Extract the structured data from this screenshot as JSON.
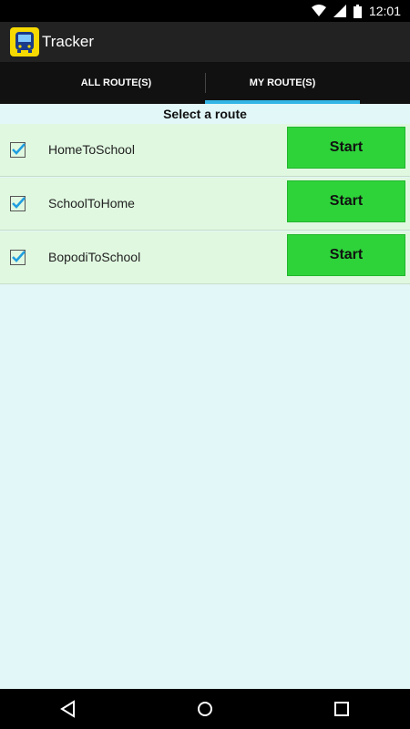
{
  "status_bar": {
    "time": "12:01",
    "icons": [
      "wifi-icon",
      "signal-icon",
      "battery-icon"
    ]
  },
  "app_bar": {
    "title": "Tracker",
    "icon": "bus-icon"
  },
  "tabs": [
    {
      "label": "ALL ROUTE(S)",
      "selected": false
    },
    {
      "label": "MY ROUTE(S)",
      "selected": true
    }
  ],
  "content": {
    "heading": "Select a route",
    "routes": [
      {
        "name": "HomeToSchool",
        "checked": true,
        "button_label": "Start"
      },
      {
        "name": "SchoolToHome",
        "checked": true,
        "button_label": "Start"
      },
      {
        "name": "BopodiToSchool",
        "checked": true,
        "button_label": "Start"
      }
    ]
  },
  "nav_bar": {
    "icons": [
      "back-icon",
      "home-icon",
      "recents-icon"
    ]
  },
  "colors": {
    "accent": "#33b5e5",
    "start_button": "#2ed33a",
    "row_background": "#e0f8e0",
    "page_background": "#e2f7f7",
    "app_icon_background": "#f5d900"
  }
}
